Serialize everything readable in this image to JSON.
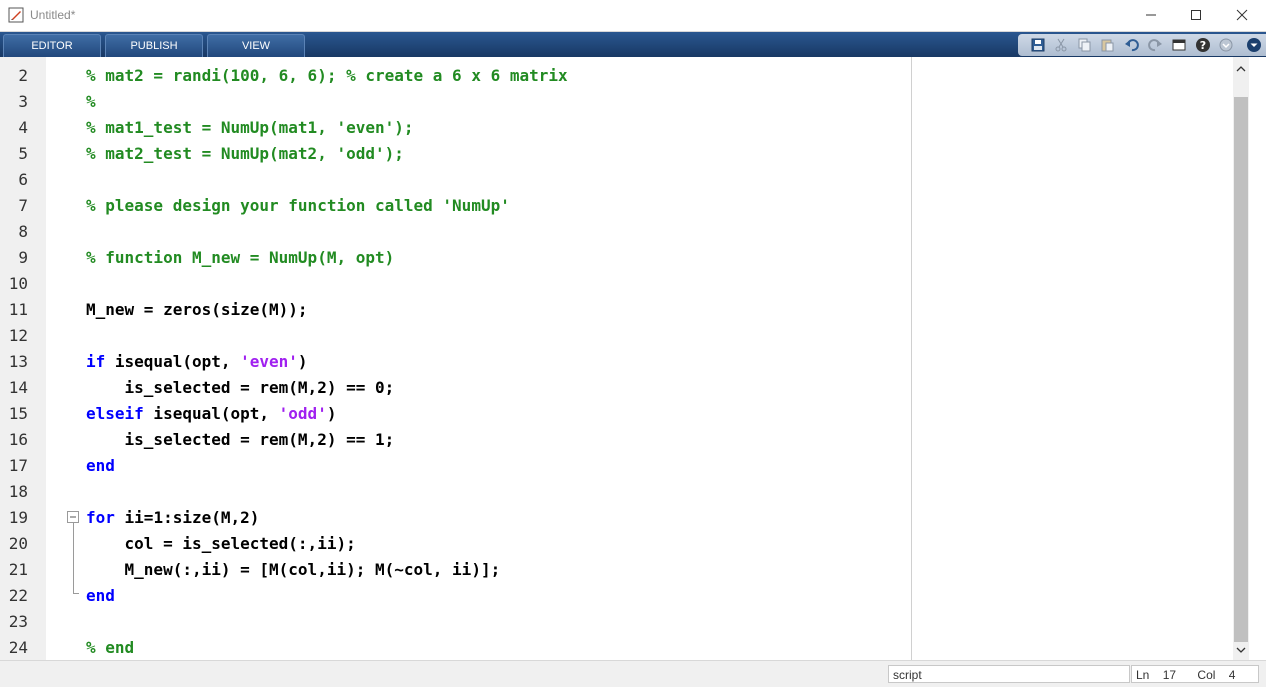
{
  "window": {
    "title": "Untitled*"
  },
  "ribbon": {
    "tabs": [
      {
        "label": "EDITOR"
      },
      {
        "label": "PUBLISH"
      },
      {
        "label": "VIEW"
      }
    ]
  },
  "editor": {
    "lines": [
      {
        "num": "2",
        "code": "% mat2 = randi(100, 6, 6); % create a 6 x 6 matrix"
      },
      {
        "num": "3",
        "code": "%"
      },
      {
        "num": "4",
        "code": "% mat1_test = NumUp(mat1, 'even');"
      },
      {
        "num": "5",
        "code": "% mat2_test = NumUp(mat2, 'odd');"
      },
      {
        "num": "6",
        "code": ""
      },
      {
        "num": "7",
        "code": "% please design your function called 'NumUp'"
      },
      {
        "num": "8",
        "code": ""
      },
      {
        "num": "9",
        "code": "% function M_new = NumUp(M, opt)"
      },
      {
        "num": "10",
        "code": ""
      },
      {
        "num": "11",
        "code": "M_new = zeros(size(M));"
      },
      {
        "num": "12",
        "code": ""
      },
      {
        "num": "13",
        "kw": "if",
        "rest": " isequal(opt, ",
        "str": "'even'",
        "tail": ")"
      },
      {
        "num": "14",
        "code": "    is_selected = rem(M,2) == 0;"
      },
      {
        "num": "15",
        "kw": "elseif",
        "rest": " isequal(opt, ",
        "str": "'odd'",
        "tail": ")"
      },
      {
        "num": "16",
        "code": "    is_selected = rem(M,2) == 1;"
      },
      {
        "num": "17",
        "kw": "end",
        "rest": "",
        "str": "",
        "tail": ""
      },
      {
        "num": "18",
        "code": ""
      },
      {
        "num": "19",
        "kw": "for",
        "rest": " ii=1:size(M,2)",
        "str": "",
        "tail": ""
      },
      {
        "num": "20",
        "code": "    col = is_selected(:,ii);"
      },
      {
        "num": "21",
        "code": "    M_new(:,ii) = [M(col,ii); M(~col, ii)];"
      },
      {
        "num": "22",
        "kw": "end",
        "rest": "",
        "str": "",
        "tail": ""
      },
      {
        "num": "23",
        "code": ""
      },
      {
        "num": "24",
        "code": "% end"
      }
    ]
  },
  "status": {
    "mode": "script",
    "ln_label": "Ln",
    "ln_value": "17",
    "col_label": "Col",
    "col_value": "4"
  },
  "colors": {
    "comment": "#228b22",
    "keyword": "#0000ff",
    "string": "#a020f0",
    "ribbon": "#1b3f6e"
  }
}
